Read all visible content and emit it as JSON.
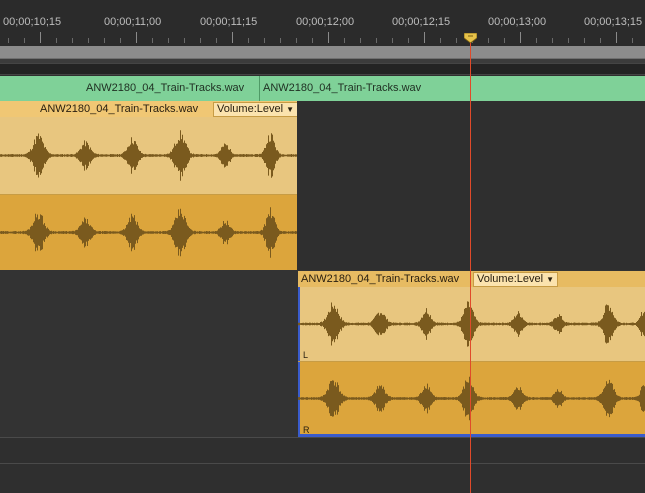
{
  "ruler": {
    "timecodes": [
      "00;00;10;15",
      "00;00;11;00",
      "00;00;11;15",
      "00;00;12;00",
      "00;00;12;15",
      "00;00;13;00",
      "00;00;13;15"
    ]
  },
  "subclips": [
    "ANW2180_04_Train-Tracks.wav",
    "ANW2180_04_Train-Tracks.wav"
  ],
  "clip1": {
    "title": "ANW2180_04_Train-Tracks.wav",
    "volume": "Volume:Level"
  },
  "clip2": {
    "title": "ANW2180_04_Train-Tracks.wav",
    "volume": "Volume:Level",
    "channel_left": "L",
    "channel_right": "R"
  },
  "colors": {
    "playhead": "#e04a2a",
    "audio_clip": "#e1ab42",
    "subclip": "#7fd198",
    "selected_border": "#3a5ccc"
  }
}
